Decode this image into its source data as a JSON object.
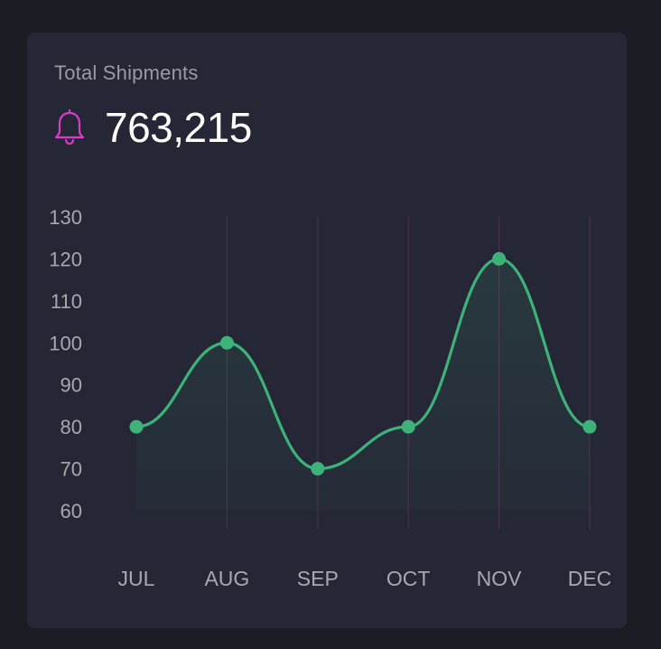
{
  "card": {
    "title": "Total Shipments",
    "value": "763,215",
    "icon": "bell-icon"
  },
  "colors": {
    "background": "#1c1d24",
    "card": "#252736",
    "line": "#3db37a",
    "icon": "#d63ec9",
    "grid": "#4a2f4e",
    "label": "#a7a8b0"
  },
  "chart_data": {
    "type": "line",
    "smooth": true,
    "area_fill": true,
    "categories": [
      "JUL",
      "AUG",
      "SEP",
      "OCT",
      "NOV",
      "DEC"
    ],
    "series": [
      {
        "values": [
          80,
          100,
          70,
          80,
          120,
          80
        ]
      }
    ],
    "yticks": [
      130,
      120,
      110,
      100,
      90,
      80,
      70,
      60
    ],
    "ylim": [
      60,
      130
    ],
    "vertical_grid": true,
    "horizontal_grid": false
  }
}
